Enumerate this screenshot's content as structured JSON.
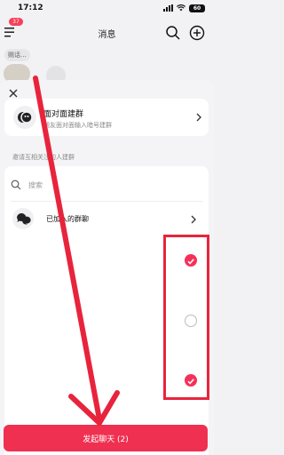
{
  "status_bar": {
    "time": "17:12",
    "battery": "60"
  },
  "header": {
    "title": "消息",
    "menu_badge": "37"
  },
  "background": {
    "tag": "赐话..."
  },
  "face_to_face": {
    "title": "面对面建群",
    "subtitle": "朋友面对面输入暗号建群"
  },
  "section_label": "邀请互相关注的人建群",
  "search": {
    "placeholder": "搜索"
  },
  "joined_group": {
    "label": "已加入的群聊"
  },
  "contacts": [
    {
      "checked": true
    },
    {
      "checked": false
    },
    {
      "checked": true
    }
  ],
  "start_button": {
    "label": "发起聊天 (2)"
  },
  "colors": {
    "accent": "#f03051",
    "annotation": "#e8243c"
  },
  "icons": [
    "menu-icon",
    "search-icon",
    "add-circle-icon",
    "close-icon",
    "face-to-face-icon",
    "chevron-right-icon",
    "group-chat-icon",
    "checkmark-icon"
  ]
}
